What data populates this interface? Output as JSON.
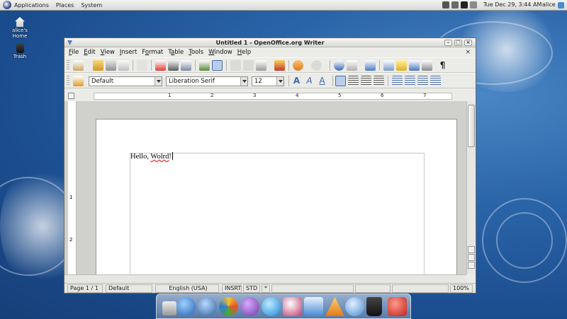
{
  "top_panel": {
    "menus": [
      "Applications",
      "Places",
      "System"
    ],
    "clock": "Tue Dec 29,  3:44 AM",
    "user": "alice"
  },
  "desktop": {
    "icons": [
      {
        "label_line1": "alice's",
        "label_line2": "Home"
      },
      {
        "label": "Trash"
      }
    ]
  },
  "window": {
    "title": "Untitled 1 - OpenOffice.org Writer",
    "menu": [
      {
        "u": "F",
        "rest": "ile"
      },
      {
        "u": "E",
        "rest": "dit"
      },
      {
        "u": "V",
        "rest": "iew"
      },
      {
        "u": "I",
        "rest": "nsert"
      },
      {
        "pre": "F",
        "u": "o",
        "rest": "rmat"
      },
      {
        "pre": "T",
        "u": "a",
        "rest": "ble"
      },
      {
        "u": "T",
        "rest": "ools"
      },
      {
        "u": "W",
        "rest": "indow"
      },
      {
        "u": "H",
        "rest": "elp"
      }
    ],
    "formatting": {
      "style": "Default",
      "font": "Liberation Serif",
      "size": "12"
    },
    "ruler_numbers": [
      "1",
      "2",
      "3",
      "4",
      "5",
      "6",
      "7"
    ],
    "vruler_numbers": [
      "1",
      "2"
    ],
    "document": {
      "text_before": "Hello, ",
      "misspelled": "Wolrd",
      "text_after": "!"
    },
    "status": {
      "page": "Page 1 / 1",
      "style": "Default",
      "language": "English (USA)",
      "insert_mode": "INSRT",
      "selection_mode": "STD",
      "modified": "*",
      "zoom": "100%"
    }
  },
  "colors": {
    "desktop_blue": "#1b4d8f",
    "spell_underline": "#e00000",
    "active_button": "#4a8ad0"
  },
  "icons": {
    "dock": [
      "finder-icon",
      "network-icon",
      "messenger-icon",
      "bird-icon",
      "skype-icon",
      "paint-icon",
      "editor-icon",
      "vlc-icon",
      "b-icon",
      "trash-icon",
      "power-icon"
    ]
  }
}
